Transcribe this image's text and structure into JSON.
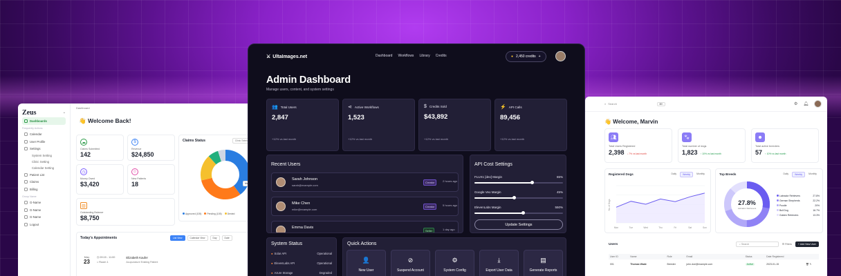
{
  "zeus": {
    "brand": "Zeus",
    "breadcrumb": "Dashboard",
    "nav": [
      {
        "label": "Dashboards",
        "active": true
      },
      {
        "label": "Calendar",
        "section": "Frequently Actions"
      },
      {
        "label": "User Profile"
      },
      {
        "label": "Settings"
      },
      {
        "label": "System Setting",
        "sub": true
      },
      {
        "label": "Clinic Setting",
        "sub": true
      },
      {
        "label": "Calendar Setting",
        "sub": true
      },
      {
        "label": "Patient List"
      },
      {
        "label": "Claims"
      },
      {
        "label": "Billing"
      },
      {
        "label": "G-Name",
        "section": "Group Name"
      },
      {
        "label": "G-Name"
      },
      {
        "label": "G-Name"
      },
      {
        "label": "Logout"
      }
    ],
    "section_frequent": "Frequently Actions",
    "section_group": "Group Name",
    "welcome": "👋 Welcome Back!",
    "stats": [
      {
        "label": "Claims Submitted",
        "value": "142",
        "color": "#2a9a47",
        "icon": "cloud-upload-icon"
      },
      {
        "label": "Revenue",
        "value": "$24,850",
        "color": "#3b82f6",
        "icon": "dollar-icon"
      },
      {
        "label": "Money Owed",
        "value": "$3,420",
        "color": "#7a5cff",
        "icon": "clock-icon"
      },
      {
        "label": "New Patients",
        "value": "18",
        "color": "#e04ca8",
        "icon": "user-icon"
      },
      {
        "label": "Outstanding Balance",
        "value": "$8,750",
        "color": "#f08c24",
        "icon": "chart-icon"
      }
    ],
    "claims_title": "Claims Status",
    "claims_filter": "Clinic Select",
    "claims_legend": [
      {
        "label": "Approved (105)",
        "color": "#2a7de1"
      },
      {
        "label": "Pending (105)",
        "color": "#ff7a1a"
      },
      {
        "label": "Denied",
        "color": "#f5c02e"
      }
    ],
    "donut_tip": "Ma...",
    "appointments_title": "Today's Appointments",
    "appt_buttons": [
      "List View",
      "Calendar View",
      "Day",
      "Date"
    ],
    "appt": {
      "month": "May",
      "day": "23",
      "time": "09:15 - 11:00",
      "room": "Room 1",
      "name": "Elizabeth Kaufer",
      "type": "Acupuncture Existing Patient"
    }
  },
  "ultra": {
    "logo": "UltaImages.net",
    "nav": [
      "Dashboard",
      "Workflows",
      "Library",
      "Credits"
    ],
    "credits": "2,450 credits",
    "title": "Admin Dashboard",
    "subtitle": "Manage users, content, and system settings",
    "kpis": [
      {
        "label": "Total Users",
        "value": "2,847",
        "change": "+12% vs last month",
        "icon": "users-icon",
        "glyph": "👥"
      },
      {
        "label": "Active Workflows",
        "value": "1,523",
        "change": "+12% vs last month",
        "icon": "share-icon",
        "glyph": "⋖"
      },
      {
        "label": "Credits Sold",
        "value": "$43,892",
        "change": "+12% vs last month",
        "icon": "dollar-icon",
        "glyph": "$"
      },
      {
        "label": "API Calls",
        "value": "89,456",
        "change": "+12% vs last month",
        "icon": "bolt-icon",
        "glyph": "⚡"
      }
    ],
    "recent_users_title": "Recent Users",
    "recent_users": [
      {
        "name": "Sarah Johnson",
        "email": "sarah@example.com",
        "role": "Creator",
        "time": "2 hours ago"
      },
      {
        "name": "Mike Chen",
        "email": "mike@example.com",
        "role": "Creator",
        "time": "5 hours ago"
      },
      {
        "name": "Emma Davis",
        "email": "",
        "role": "Seller",
        "time": "1 day ago"
      }
    ],
    "api_title": "API Cost Settings",
    "api": [
      {
        "label": "FLUX1 [dev] Margin",
        "value": "65%",
        "fill": 0.65
      },
      {
        "label": "Google Veo Margin",
        "value": "45%",
        "fill": 0.45
      },
      {
        "label": "ElevenLabs Margin",
        "value": "550%",
        "fill": 0.55
      }
    ],
    "update_label": "Update Settings",
    "system_title": "System Status",
    "system": [
      {
        "label": "Solar API",
        "status": "Operational"
      },
      {
        "label": "ElevenLabs API",
        "status": "Operational"
      },
      {
        "label": "Azure Storage",
        "status": "Degraded"
      }
    ],
    "quick_title": "Quick Actions",
    "quick": [
      {
        "label": "New User",
        "icon": "add-user-icon",
        "glyph": "👤"
      },
      {
        "label": "Suspend Account",
        "icon": "ban-icon",
        "glyph": "⊘"
      },
      {
        "label": "System Config",
        "icon": "gear-icon",
        "glyph": "⚙"
      },
      {
        "label": "Export User Data",
        "icon": "download-icon",
        "glyph": "⤓"
      },
      {
        "label": "Generate Reports",
        "icon": "report-icon",
        "glyph": "▤"
      }
    ]
  },
  "marvin": {
    "search_placeholder": "Search",
    "search_kbd": "⌘K",
    "welcome": "👋 Welcome, Marvin",
    "stats": [
      {
        "label": "Total Users Registered",
        "value": "2,398",
        "trend": "↓ 7% vs last month",
        "trend_color": "#e0413b",
        "icon": "users-icon"
      },
      {
        "label": "Total number of dogs",
        "value": "1,823",
        "trend": "↑ 10% vs last month",
        "trend_color": "#1f9a4a",
        "icon": "paw-icon"
      },
      {
        "label": "Total active breeders",
        "value": "57",
        "trend": "↑ 10% vs last month",
        "trend_color": "#1f9a4a",
        "icon": "breeder-icon"
      }
    ],
    "reg_title": "Registered Dogs",
    "reg_tabs": [
      "Daily",
      "Weekly",
      "Monthly"
    ],
    "reg_active": "Weekly",
    "ylabel": "No. of Dogs",
    "days": [
      "Mon",
      "Tue",
      "Wed",
      "Thu",
      "Fri",
      "Sat",
      "Sun"
    ],
    "reg_values": [
      42,
      58,
      50,
      64,
      57,
      70,
      80
    ],
    "breeds_title": "Top Breeds",
    "breeds_tabs": [
      "Daily",
      "Weekly",
      "Monthly"
    ],
    "breeds_active": "Weekly",
    "breeds_center": "27.8%",
    "breeds_center_sub": "Labrador Retrievers",
    "breeds": [
      {
        "label": "Labrador Retrievers",
        "value": "27.8%",
        "color": "#6a5cf0"
      },
      {
        "label": "German Shepherds",
        "value": "22.2%",
        "color": "#8f82f5"
      },
      {
        "label": "Poodle",
        "value": "20%",
        "color": "#b1a8f8"
      },
      {
        "label": "Bull Dog",
        "value": "16.7%",
        "color": "#cdc8fb"
      },
      {
        "label": "Golden Retrievers",
        "value": "13.3%",
        "color": "#e3e0fd"
      }
    ],
    "users_title": "Users",
    "users_search": "Search",
    "filters": "Filters",
    "add_user": "+ Add New User",
    "table_head": [
      "User ID",
      "Name",
      "Role",
      "Email",
      "Status",
      "Date Registered"
    ],
    "table_rows": [
      [
        "001",
        "Thomas Wade",
        "Breeder",
        "john.doe@example.com",
        "Active",
        "2023-01-15"
      ]
    ]
  }
}
